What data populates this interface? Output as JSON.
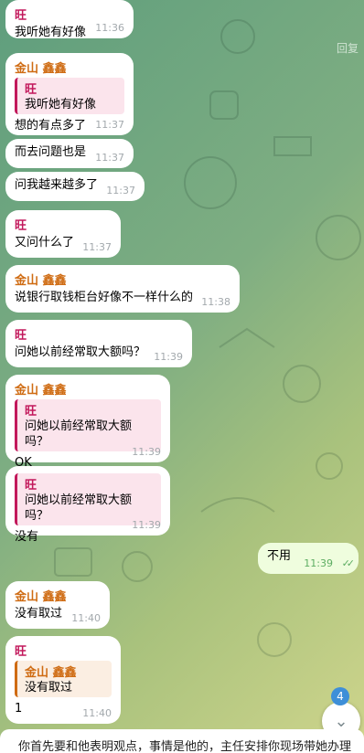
{
  "reply_hint": "回复",
  "messages": [
    {
      "sender": "旺",
      "text": "我听她有好像",
      "time": "11:36"
    },
    {
      "sender": "金山 鑫鑫",
      "quote_sender": "旺",
      "quote_text": "我听她有好像",
      "text": "想的有点多了",
      "time": "11:37"
    },
    {
      "text": "而去问题也是",
      "time": "11:37"
    },
    {
      "text": "问我越来越多了",
      "time": "11:37"
    },
    {
      "sender": "旺",
      "text": "又问什么了",
      "time": "11:37"
    },
    {
      "sender": "金山 鑫鑫",
      "text": "说银行取钱柜台好像不一样什么的",
      "time": "11:38"
    },
    {
      "sender": "旺",
      "text": "问她以前经常取大额吗？",
      "time": "11:39"
    },
    {
      "sender": "金山 鑫鑫",
      "quote_sender": "旺",
      "quote_text": "问她以前经常取大额吗？",
      "text": "OK",
      "time": "11:39"
    },
    {
      "quote_sender": "旺",
      "quote_text": "问她以前经常取大额吗？",
      "text": "没有",
      "time": "11:39"
    },
    {
      "text": "不用",
      "time": "11:39",
      "outgoing": true
    },
    {
      "sender": "金山 鑫鑫",
      "text": "没有取过",
      "time": "11:40"
    },
    {
      "sender": "旺",
      "quote_sender": "金山 鑫鑫",
      "quote_text": "没有取过",
      "text": "1",
      "time": "11:40"
    }
  ],
  "unread_badge": "4",
  "composer_text": "你首先要和他表明观点，事情是他的，主任安排你现场带她办理",
  "colors": {
    "wang": "#c2185b",
    "jin": "#cf6b12",
    "outgoing": "#effdde",
    "incoming": "#ffffff"
  },
  "icons": {
    "scroll_down": "chevron-down-icon",
    "read_receipt": "double-check-icon"
  }
}
